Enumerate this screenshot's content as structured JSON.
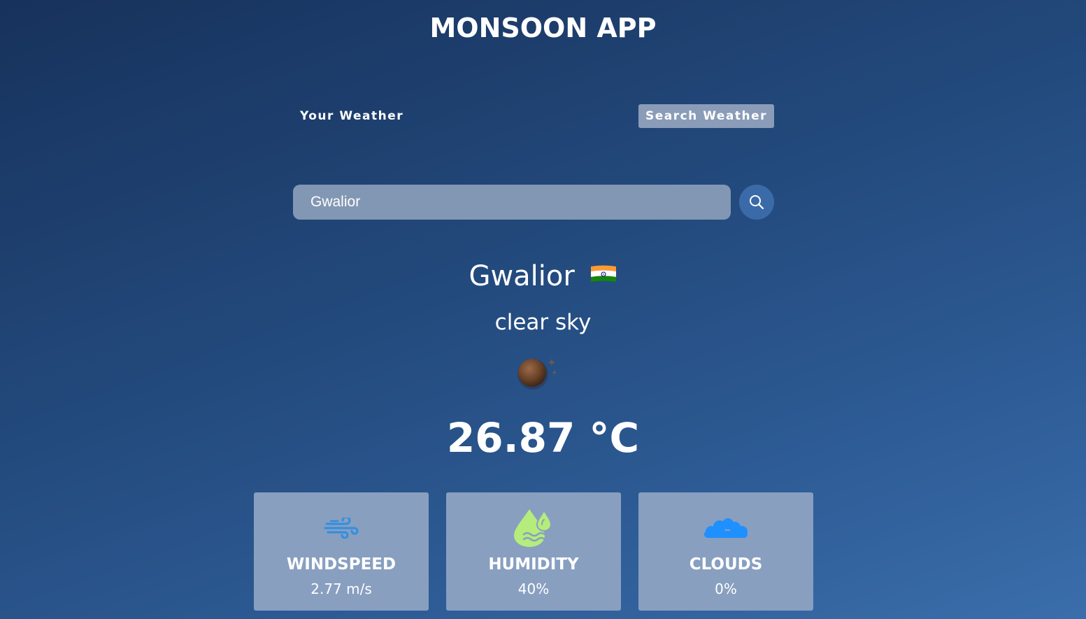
{
  "app": {
    "title": "MONSOON APP"
  },
  "tabs": {
    "your_weather": "Your Weather",
    "search_weather": "Search Weather",
    "active": "search_weather"
  },
  "search": {
    "value": "Gwalior",
    "icon": "search-icon"
  },
  "weather": {
    "city": "Gwalior",
    "country_flag_icon": "india-flag-icon",
    "description": "clear sky",
    "condition_icon": "clear-sky-icon",
    "temperature": "26.87 °C"
  },
  "stats": [
    {
      "label": "WINDSPEED",
      "value": "2.77 m/s",
      "icon": "wind-icon"
    },
    {
      "label": "HUMIDITY",
      "value": "40%",
      "icon": "humidity-icon"
    },
    {
      "label": "CLOUDS",
      "value": "0%",
      "icon": "clouds-icon"
    }
  ],
  "colors": {
    "background_top": "#17325c",
    "background_bottom": "#3a6eab",
    "card": "#889fc0",
    "search_field": "#8297b3",
    "search_button": "#3b6aa8",
    "wind_icon": "#2f8fe0",
    "humidity_icon": "#b5ec7c",
    "clouds_icon": "#1e90ff"
  }
}
